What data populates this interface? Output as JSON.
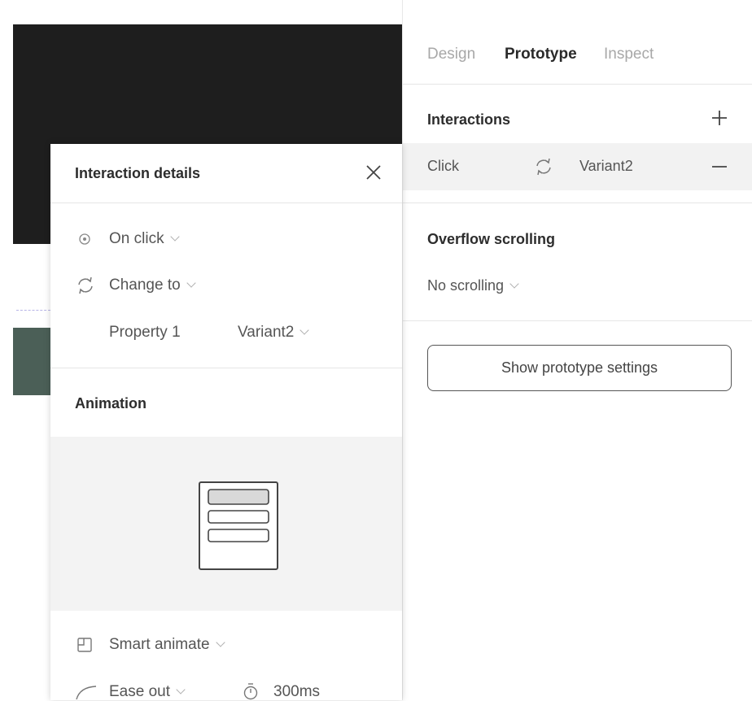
{
  "tabs": [
    {
      "label": "Design",
      "active": false
    },
    {
      "label": "Prototype",
      "active": true
    },
    {
      "label": "Inspect",
      "active": false
    }
  ],
  "interactions": {
    "title": "Interactions",
    "trigger": "Click",
    "icon": "refresh-icon",
    "target": "Variant2"
  },
  "overflow": {
    "title": "Overflow scrolling",
    "value": "No scrolling"
  },
  "prototype_settings_label": "Show prototype settings",
  "interaction_details": {
    "title": "Interaction details",
    "trigger": "On click",
    "action": "Change to",
    "property_label": "Property 1",
    "property_value": "Variant2",
    "animation_title": "Animation",
    "animation_type": "Smart animate",
    "easing": "Ease out",
    "duration": "300ms"
  },
  "colors": {
    "canvas_dark": "#1e1e1e",
    "canvas_frame": "#4b5f57",
    "row_highlight": "#f2f2f2"
  }
}
